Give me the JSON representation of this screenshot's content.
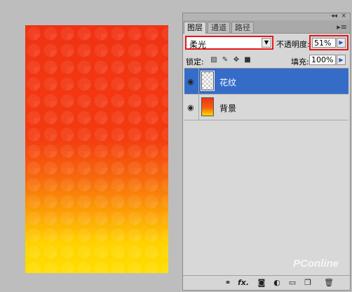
{
  "canvas": {
    "gradient_colors": [
      "#f03212",
      "#f76a0c",
      "#fcaa06",
      "#ffdd00"
    ]
  },
  "panel": {
    "tabs": [
      {
        "label": "图层",
        "active": true
      },
      {
        "label": "通道",
        "active": false
      },
      {
        "label": "路径",
        "active": false
      }
    ],
    "topbar_icons": {
      "collapse": "collapse-icon",
      "close": "close-icon"
    },
    "blend_mode": "柔光",
    "opacity_label": "不透明度:",
    "opacity_value": "51%",
    "lock_label": "锁定:",
    "lock_icons": [
      "lock-transparent-icon",
      "lock-paint-icon",
      "lock-move-icon",
      "lock-all-icon"
    ],
    "fill_label": "填充:",
    "fill_value": "100%",
    "layers": [
      {
        "name": "花纹",
        "selected": true,
        "visible": true,
        "thumbnail": "transparent"
      },
      {
        "name": "背景",
        "selected": false,
        "visible": true,
        "thumbnail": "gradient"
      }
    ],
    "bottom_icons": [
      "link-icon",
      "fx-icon",
      "mask-icon",
      "adjustment-icon",
      "group-icon",
      "new-layer-icon",
      "trash-icon"
    ],
    "fx_label": "fx."
  },
  "accent": {
    "highlight_red": "#e8161a",
    "selection_blue": "#346cc8"
  },
  "watermark": "PConline"
}
